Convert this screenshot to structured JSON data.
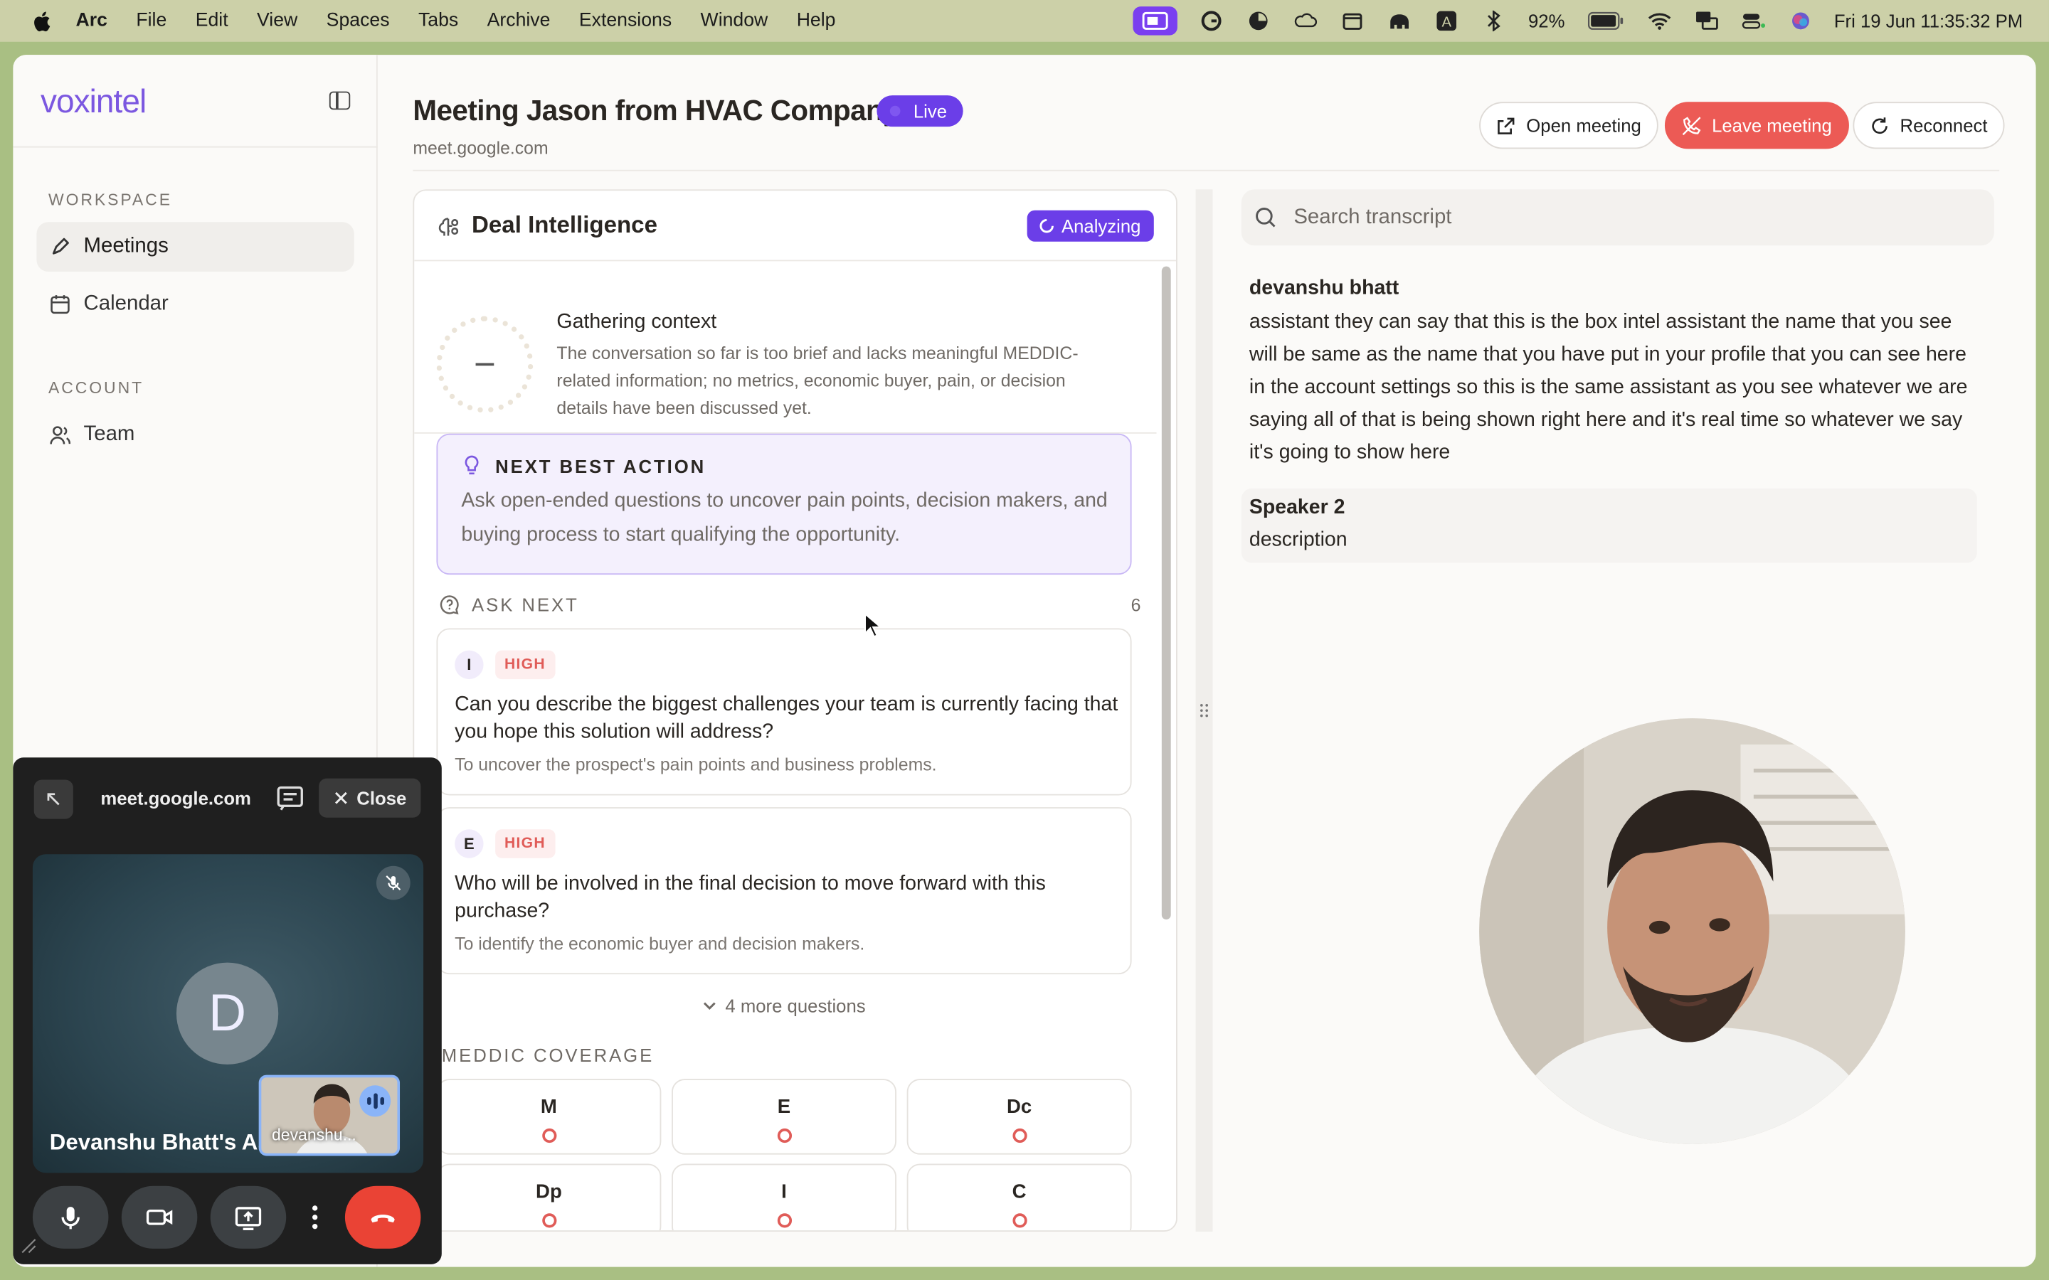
{
  "menubar": {
    "app": "Arc",
    "items": [
      "File",
      "Edit",
      "View",
      "Spaces",
      "Tabs",
      "Archive",
      "Extensions",
      "Window",
      "Help"
    ],
    "battery": "92%",
    "datetime": "Fri 19 Jun  11:35:32 PM",
    "tray_icons": [
      "screen-share-icon",
      "grammarly-icon",
      "pie-icon",
      "cloud-icon",
      "clapper-icon",
      "elephant-icon",
      "input-a-icon",
      "bluetooth-icon",
      "battery-icon",
      "wifi-icon",
      "mirroring-icon",
      "control-center-icon",
      "siri-icon"
    ],
    "accent": "#7a3ff0"
  },
  "sidebar": {
    "logo": "voxintel",
    "workspace_label": "WORKSPACE",
    "account_label": "ACCOUNT",
    "items": [
      {
        "label": "Meetings",
        "icon": "pen-icon",
        "active": true
      },
      {
        "label": "Calendar",
        "icon": "calendar-icon",
        "active": false
      },
      {
        "label": "Team",
        "icon": "users-icon",
        "active": false
      }
    ]
  },
  "header": {
    "title": "Meeting Jason from HVAC Company",
    "status": "Live",
    "domain": "meet.google.com",
    "buttons": {
      "open": "Open meeting",
      "leave": "Leave meeting",
      "reconnect": "Reconnect"
    }
  },
  "deal": {
    "title": "Deal Intelligence",
    "status": "Analyzing",
    "gathering_title": "Gathering context",
    "gathering_text": "The conversation so far is too brief and lacks meaningful MEDDIC-related information; no metrics, economic buyer, pain, or decision details have been discussed yet.",
    "nba_label": "NEXT BEST ACTION",
    "nba_text": "Ask open-ended questions to uncover pain points, decision makers, and buying process to start qualifying the opportunity.",
    "ask_next_label": "ASK NEXT",
    "ask_next_count": "6",
    "questions": [
      {
        "letter": "I",
        "priority": "HIGH",
        "text": "Can you describe the biggest challenges your team is currently facing that you hope this solution will address?",
        "why": "To uncover the prospect's pain points and business problems."
      },
      {
        "letter": "E",
        "priority": "HIGH",
        "text": "Who will be involved in the final decision to move forward with this purchase?",
        "why": "To identify the economic buyer and decision makers."
      }
    ],
    "more_label": "4 more questions",
    "meddic_label": "MEDDIC COVERAGE",
    "meddic": [
      "M",
      "E",
      "Dc",
      "Dp",
      "I",
      "C"
    ],
    "colors": {
      "primary": "#6b3ee8",
      "high": "#e05c58"
    }
  },
  "transcript": {
    "search_placeholder": "Search transcript",
    "entries": [
      {
        "speaker": "devanshu bhatt",
        "text": "assistant they can say that this is the box intel assistant the name that you see will be same as the name that you have put in your profile that you can see here in the account settings so this is the same assistant as you see whatever we are saying all of that is being shown right here and it's real time so whatever we say it's going to show here"
      },
      {
        "speaker": "Speaker 2",
        "text": "description"
      }
    ]
  },
  "pip": {
    "host": "meet.google.com",
    "close_label": "Close",
    "avatar_letter": "D",
    "participant": "Devanshu Bhatt's As",
    "self_label": "devanshu..."
  }
}
